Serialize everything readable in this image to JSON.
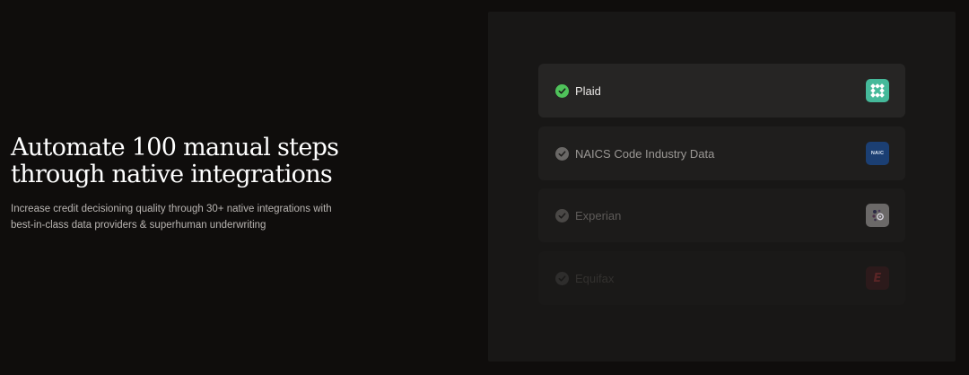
{
  "hero": {
    "title_lines": [
      "Automate 100 manual steps",
      "through native integrations"
    ],
    "subtitle_lines": [
      "Increase credit decisioning quality through 30+ native integrations with",
      "best-in-class data providers & superhuman underwriting"
    ]
  },
  "integrations": [
    {
      "label": "Plaid",
      "status": "checked",
      "logo": "plaid-logo-icon",
      "color": "#45b99a"
    },
    {
      "label": "NAICS Code Industry Data",
      "status": "checked",
      "logo": "naics-logo-icon",
      "logo_text": "NAIC",
      "color": "#1b3f73"
    },
    {
      "label": "Experian",
      "status": "checked",
      "logo": "experian-logo-icon",
      "color": "#6b6968"
    },
    {
      "label": "Equifax",
      "status": "checked",
      "logo": "equifax-logo-icon",
      "logo_text": "E",
      "color": "#2c1a1b"
    }
  ],
  "colors": {
    "background": "#0f0d0c",
    "panel": "#181716",
    "check_active": "#4fc25a"
  }
}
